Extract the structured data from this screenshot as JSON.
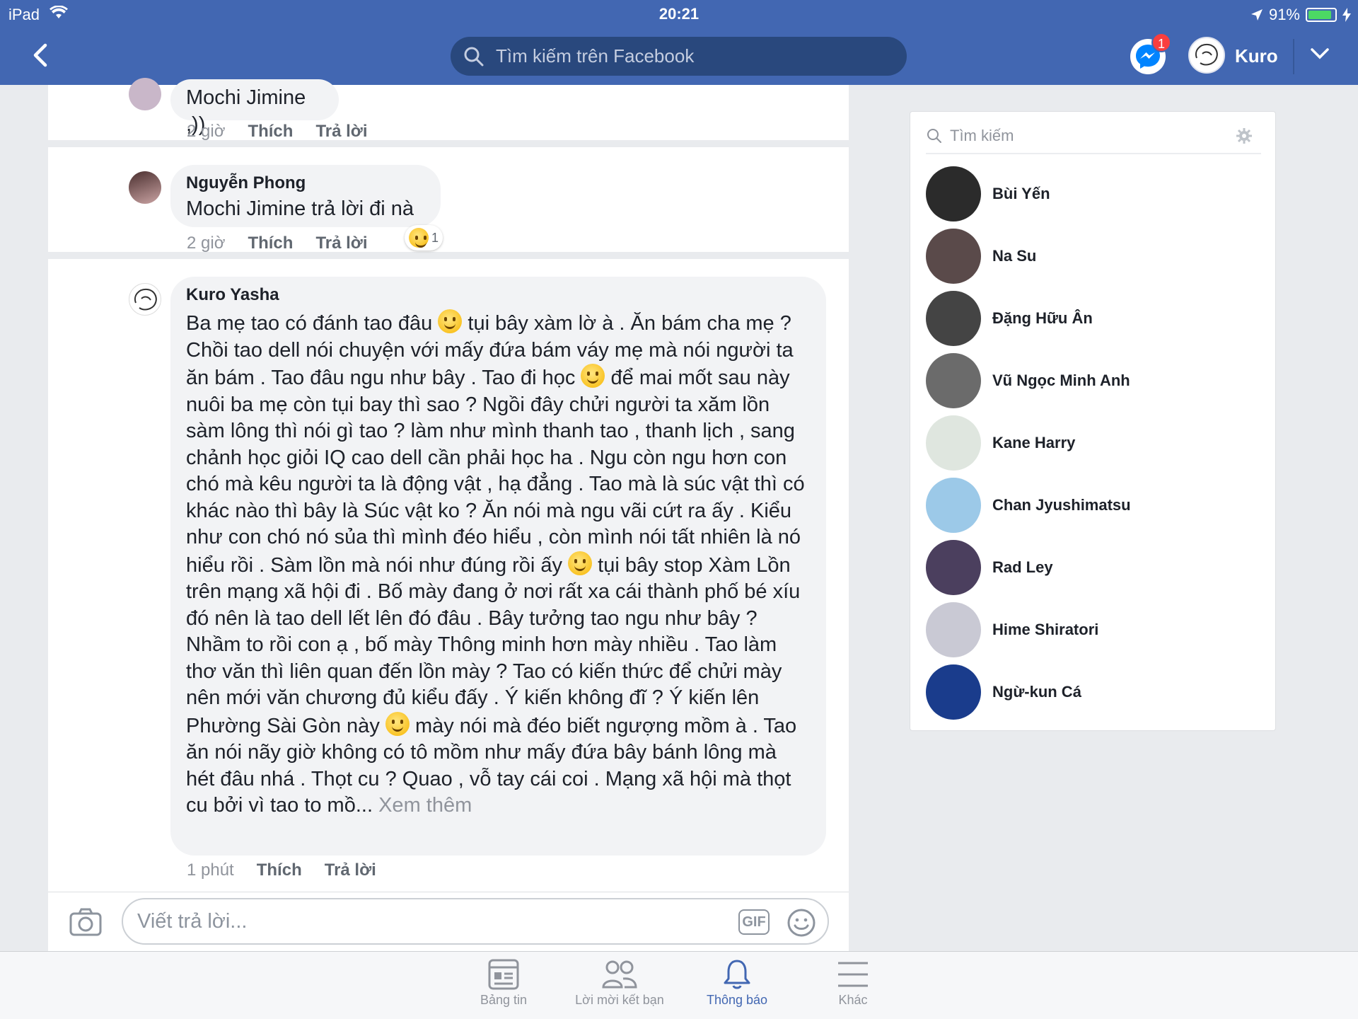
{
  "status_bar": {
    "carrier": "iPad",
    "time": "20:21",
    "battery": "91%"
  },
  "header": {
    "search_placeholder": "Tìm kiếm trên Facebook",
    "messenger_badge": "1",
    "user_name": "Kuro"
  },
  "comments": [
    {
      "name": "",
      "text": "Mochi Jimine ,))",
      "time": "2 giờ",
      "like": "Thích",
      "reply": "Trả lời"
    },
    {
      "name": "Nguyễn Phong",
      "text": "Mochi Jimine trả lời đi nà",
      "time": "2 giờ",
      "like": "Thích",
      "reply": "Trả lời",
      "reaction_count": "1"
    },
    {
      "name": "Kuro Yasha",
      "paragraphs": [
        "Ba mẹ tao có đánh tao đâu",
        "tụi bây xàm lờ à . Ăn bám cha mẹ ? Chồi tao dell nói chuyện với mấy đứa bám váy mẹ mà nói người ta ăn bám . Tao đâu ngu như bây . Tao đi học",
        "để mai mốt sau này nuôi ba mẹ còn tụi bay thì sao ? Ngồi đây chửi người ta xăm lồn sàm lông thì nói gì tao ? làm như mình thanh tao , thanh lịch , sang chảnh học giỏi IQ cao dell cần phải học ha . Ngu còn ngu hơn con chó mà kêu người ta là động vật , hạ đẳng . Tao mà là súc vật thì có khác nào thì bây là Súc vật ko ? Ăn nói mà ngu vãi cứt ra ấy . Kiểu như con chó nó sủa thì mình đéo hiểu , còn mình nói tất nhiên là nó hiểu rồi . Sàm lồn mà nói như đúng rồi ấy",
        "tụi bây stop Xàm Lồn trên mạng xã hội đi . Bố mày đang ở nơi rất xa cái thành phố bé xíu đó nên là tao dell lết lên đó đâu . Bây tưởng tao ngu như bây ? Nhầm to rồi con ạ , bố mày Thông minh hơn mày nhiều . Tao làm thơ văn thì liên quan đến lồn mày ? Tao có kiến thức để chửi mày nên mới văn chương đủ kiểu đấy . Ý kiến không đĩ ? Ý kiến lên Phường Sài Gòn này",
        "mày nói mà đéo biết ngượng mồm à . Tao ăn nói nãy giờ không có tô mồm như mấy đứa bây bánh lông mà hét đâu nhá . Thọt cu ? Quao , vỗ tay cái coi . Mạng xã hội mà thọt cu bởi vì tao to mồ..."
      ],
      "see_more": "Xem thêm",
      "time": "1 phút",
      "like": "Thích",
      "reply": "Trả lời"
    }
  ],
  "composer": {
    "placeholder": "Viết trả lời...",
    "gif_label": "GIF"
  },
  "tabs": [
    {
      "label": "Bảng tin",
      "icon": "news-feed-icon"
    },
    {
      "label": "Lời mời kết bạn",
      "icon": "friends-icon"
    },
    {
      "label": "Thông báo",
      "icon": "bell-icon",
      "active": true
    },
    {
      "label": "Khác",
      "icon": "menu-icon"
    }
  ],
  "contacts": {
    "search_placeholder": "Tìm kiếm",
    "list": [
      {
        "name": "Bùi Yến",
        "color": "#2b2b2b"
      },
      {
        "name": "Na Su",
        "color": "#5a4a4a"
      },
      {
        "name": "Đặng Hữu Ân",
        "color": "#444444"
      },
      {
        "name": "Vũ Ngọc Minh Anh",
        "color": "#6b6b6b"
      },
      {
        "name": "Kane Harry",
        "color": "#dfe6df"
      },
      {
        "name": "Chan Jyushimatsu",
        "color": "#9cc9e8"
      },
      {
        "name": "Rad Ley",
        "color": "#4b3f5e"
      },
      {
        "name": "Hime Shiratori",
        "color": "#c9c9d4"
      },
      {
        "name": "Ngừ-kun Cá",
        "color": "#1a3c8c"
      }
    ]
  },
  "colors": {
    "brand": "#4267b2",
    "badge": "#fa3e3e",
    "bubble": "#f2f3f5"
  }
}
